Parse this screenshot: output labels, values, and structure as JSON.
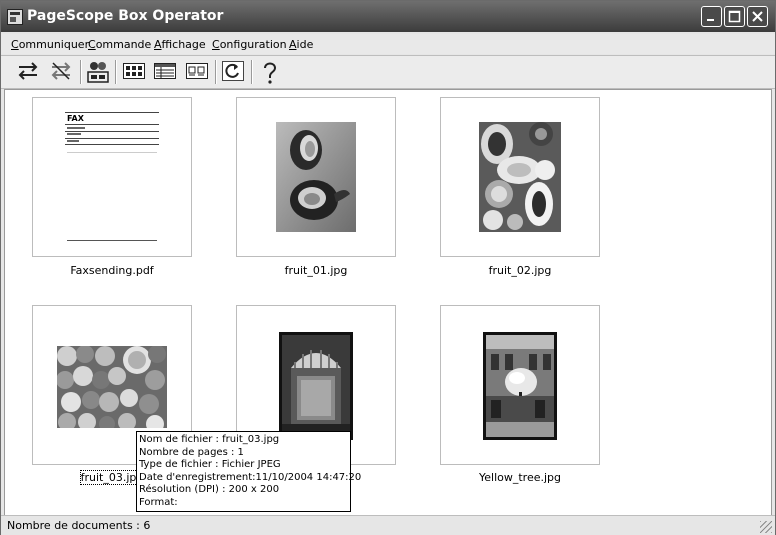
{
  "window": {
    "title": "PageScope Box Operator"
  },
  "menu": [
    {
      "label": "Communiquer",
      "mnemonic": "C",
      "rest": "ommuniquer"
    },
    {
      "label": "Commande",
      "mnemonic": "C",
      "rest": "ommande"
    },
    {
      "label": "Affichage",
      "mnemonic": "A",
      "rest": "ffichage"
    },
    {
      "label": "Configuration",
      "mnemonic": "C",
      "rest": "onfiguration"
    },
    {
      "label": "Aide",
      "mnemonic": "A",
      "rest": "ide"
    }
  ],
  "toolbar": {
    "icons": [
      "transfer-icon",
      "disconnect-icon",
      "users-icon",
      "large-icons-view-icon",
      "list-view-icon",
      "details-view-icon",
      "refresh-icon",
      "help-icon"
    ]
  },
  "files": [
    {
      "name": "Faxsending.pdf"
    },
    {
      "name": "fruit_01.jpg"
    },
    {
      "name": "fruit_02.jpg"
    },
    {
      "name": "fruit_03.jpg"
    },
    {
      "name": ""
    },
    {
      "name": "Yellow_tree.jpg"
    }
  ],
  "fax_doc": {
    "header": "FAX"
  },
  "tooltip": {
    "lines": [
      "Nom de fichier : fruit_03.jpg",
      "Nombre de pages : 1",
      "Type de fichier : Fichier JPEG",
      "Date d'enregistrement:11/10/2004 14:47:20",
      "Résolution (DPI) : 200 x 200",
      "Format:"
    ]
  },
  "status": {
    "text": "Nombre de documents : 6"
  },
  "colors": {
    "titlebar": "#4a4a4a",
    "background": "#ffffff"
  }
}
